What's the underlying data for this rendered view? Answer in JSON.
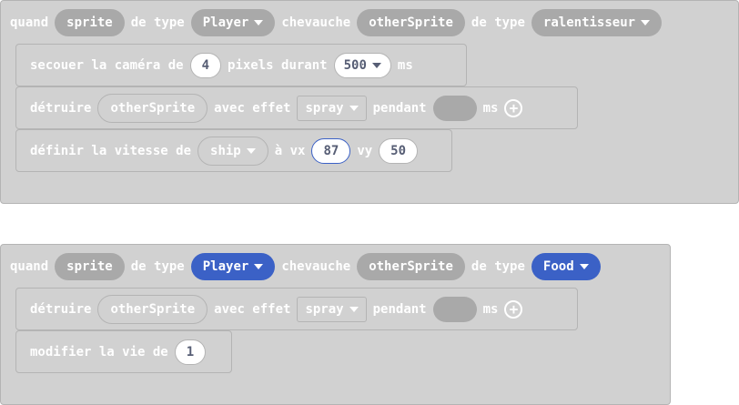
{
  "block1": {
    "w_quand": "quand",
    "sprite": "sprite",
    "w_de_type1": "de type",
    "kind1": "Player",
    "w_chevauche": "chevauche",
    "other": "otherSprite",
    "w_de_type2": "de type",
    "kind2": "ralentisseur",
    "shake": {
      "t1": "secouer la caméra de",
      "val": "4",
      "t2": "pixels durant",
      "dur": "500",
      "t3": "ms"
    },
    "destroy": {
      "t1": "détruire",
      "target": "otherSprite",
      "t2": "avec effet",
      "effect": "spray",
      "t3": "pendant",
      "t4": "ms"
    },
    "vel": {
      "t1": "définir la vitesse de",
      "target": "ship",
      "t2": "à vx",
      "vx": "87",
      "t3": "vy",
      "vy": "50"
    }
  },
  "block2": {
    "w_quand": "quand",
    "sprite": "sprite",
    "w_de_type1": "de type",
    "kind1": "Player",
    "w_chevauche": "chevauche",
    "other": "otherSprite",
    "w_de_type2": "de type",
    "kind2": "Food",
    "destroy": {
      "t1": "détruire",
      "target": "otherSprite",
      "t2": "avec effet",
      "effect": "spray",
      "t3": "pendant",
      "t4": "ms"
    },
    "life": {
      "t1": "modifier la vie de",
      "val": "1"
    }
  }
}
